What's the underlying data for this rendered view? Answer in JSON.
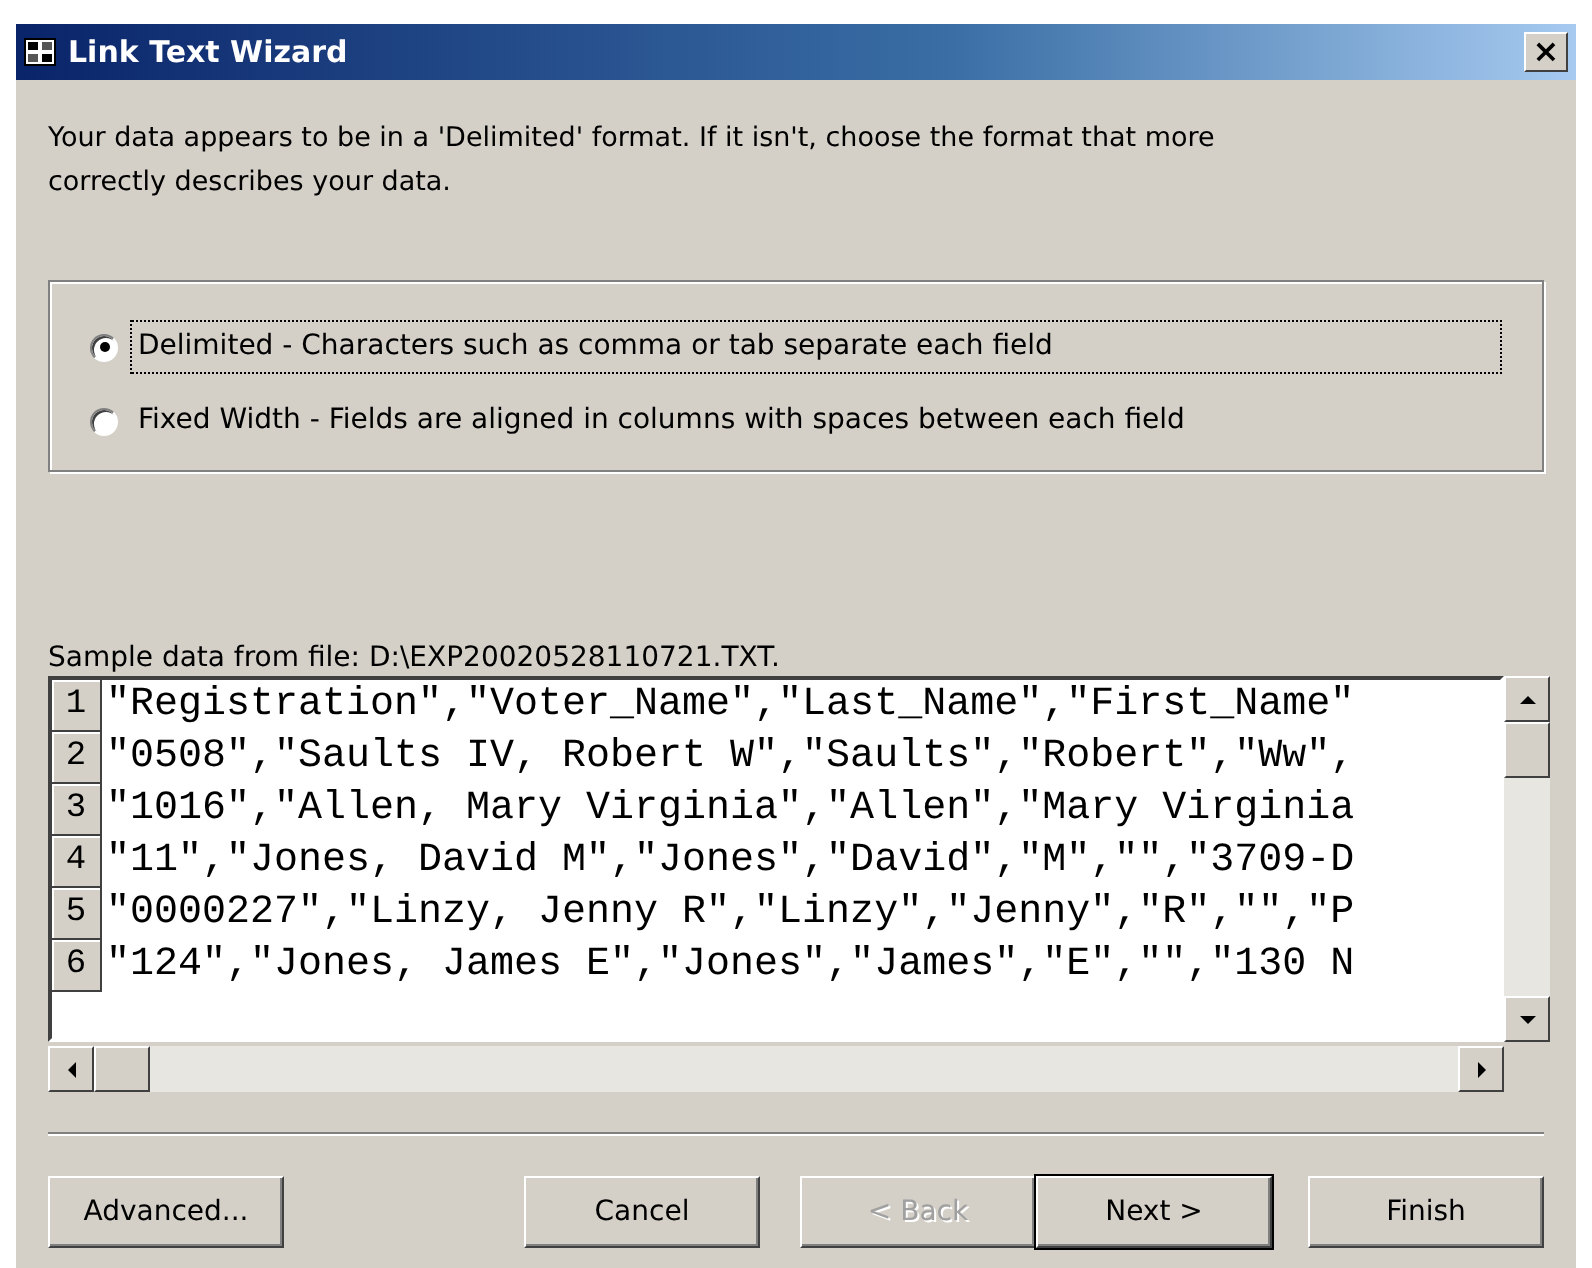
{
  "window": {
    "title": "Link Text Wizard",
    "close": "×"
  },
  "intro": "Your data appears to be in a 'Delimited' format. If it isn't, choose the format that more correctly describes your data.",
  "format_options": [
    {
      "label": "Delimited - Characters such as comma or tab separate each field",
      "selected": true,
      "focused": true
    },
    {
      "label": "Fixed Width - Fields are aligned in columns with spaces between each field",
      "selected": false,
      "focused": false
    }
  ],
  "sample": {
    "label": "Sample data from file: D:\\EXP20020528110721.TXT.",
    "rows": [
      {
        "number": "1",
        "text": "\"Registration\",\"Voter_Name\",\"Last_Name\",\"First_Name\""
      },
      {
        "number": "2",
        "text": "\"0508\",\"Saults IV, Robert W\",\"Saults\",\"Robert\",\"Ww\","
      },
      {
        "number": "3",
        "text": "\"1016\",\"Allen, Mary Virginia\",\"Allen\",\"Mary Virginia"
      },
      {
        "number": "4",
        "text": "\"11\",\"Jones, David M\",\"Jones\",\"David\",\"M\",\"\",\"3709-D"
      },
      {
        "number": "5",
        "text": "\"0000227\",\"Linzy, Jenny R\",\"Linzy\",\"Jenny\",\"R\",\"\",\"P"
      },
      {
        "number": "6",
        "text": "\"124\",\"Jones, James E\",\"Jones\",\"James\",\"E\",\"\",\"130 N"
      }
    ]
  },
  "buttons": [
    {
      "label": "Advanced...",
      "disabled": false,
      "default": false
    },
    {
      "label": "Cancel",
      "disabled": false,
      "default": false
    },
    {
      "label": "< Back",
      "disabled": true,
      "default": false
    },
    {
      "label": "Next >",
      "disabled": false,
      "default": true
    },
    {
      "label": "Finish",
      "disabled": false,
      "default": false
    }
  ]
}
